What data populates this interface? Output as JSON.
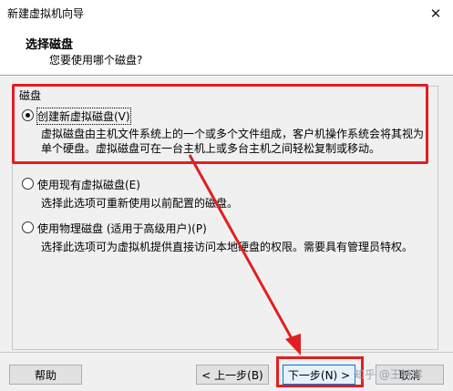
{
  "window": {
    "title": "新建虚拟机向导"
  },
  "header": {
    "title": "选择磁盘",
    "subtitle": "您要使用哪个磁盘?"
  },
  "group": {
    "label": "磁盘"
  },
  "options": [
    {
      "label": "创建新虚拟磁盘(V)",
      "selected": true,
      "desc_line1": "虚拟磁盘由主机文件系统上的一个或多个文件组成，客户机操作系统会将其视为",
      "desc_line2": "单个硬盘。虚拟磁盘可在一台主机上或多台主机之间轻松复制或移动。"
    },
    {
      "label": "使用现有虚拟磁盘(E)",
      "selected": false,
      "desc_line1": "选择此选项可重新使用以前配置的磁盘。"
    },
    {
      "label": "使用物理磁盘 (适用于高级用户)(P)",
      "selected": false,
      "desc_line1": "选择此选项可为虚拟机提供直接访问本地硬盘的权限。需要具有管理员特权。"
    }
  ],
  "buttons": {
    "help": "帮助",
    "back": "< 上一步(B)",
    "next": "下一步(N) >",
    "cancel": "取消"
  },
  "watermark": "知乎 @王特洋",
  "colors": {
    "annotation_red": "#e02020",
    "dialog_bg": "#f0f0f0",
    "default_button_border": "#0078d7"
  },
  "icons": {
    "close": "close-icon"
  }
}
